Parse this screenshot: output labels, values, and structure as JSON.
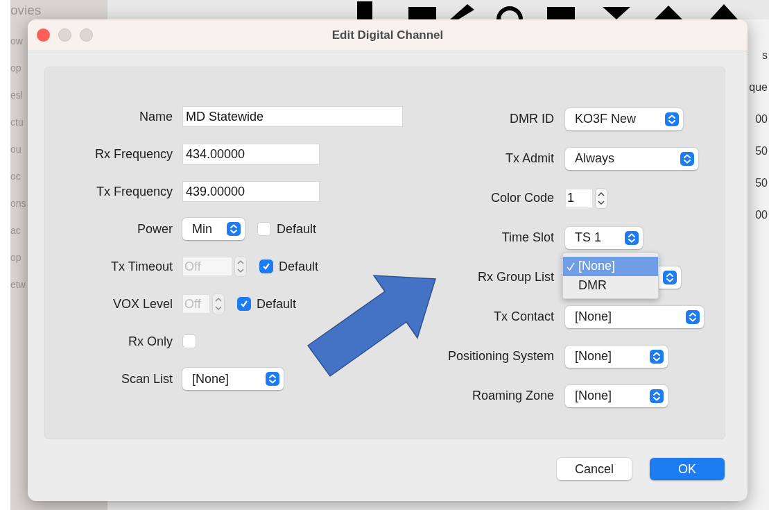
{
  "background": {
    "sidebar_items": [
      "ovies",
      "ow",
      "op",
      "esl",
      "ctu",
      "ou",
      "oc",
      "ons",
      "ac",
      "op",
      "etw"
    ],
    "table_fragments": [
      "s",
      "que",
      "00",
      "50",
      "50",
      "00"
    ]
  },
  "dialog": {
    "title": "Edit Digital Channel",
    "left_fields": [
      {
        "label": "Name",
        "kind": "text",
        "value": "MD Statewide"
      },
      {
        "label": "Rx Frequency",
        "kind": "text",
        "value": "434.00000"
      },
      {
        "label": "Tx Frequency",
        "kind": "text",
        "value": "439.00000"
      },
      {
        "label": "Power",
        "kind": "popup",
        "value": "Min",
        "checkbox": {
          "label": "Default",
          "checked": false
        }
      },
      {
        "label": "Tx Timeout",
        "kind": "stepper",
        "value": "Off",
        "disabled": true,
        "checkbox": {
          "label": "Default",
          "checked": true
        }
      },
      {
        "label": "VOX Level",
        "kind": "stepper",
        "value": "Off",
        "disabled": true,
        "checkbox": {
          "label": "Default",
          "checked": true
        }
      },
      {
        "label": "Rx Only",
        "kind": "checkbox",
        "checked": false
      },
      {
        "label": "Scan List",
        "kind": "popup",
        "value": "[None]"
      }
    ],
    "right_fields": [
      {
        "label": "DMR ID",
        "kind": "popup",
        "value": "KO3F New"
      },
      {
        "label": "Tx Admit",
        "kind": "popup",
        "value": "Always"
      },
      {
        "label": "Color Code",
        "kind": "stepper",
        "value": "1",
        "disabled": false
      },
      {
        "label": "Time Slot",
        "kind": "popup",
        "value": "TS 1"
      },
      {
        "label": "Rx Group List",
        "kind": "popup",
        "menu": [
          {
            "label": "[None]",
            "selected": true
          },
          {
            "label": "DMR",
            "selected": false
          }
        ]
      },
      {
        "label": "Tx Contact",
        "kind": "popup",
        "value": "[None]"
      },
      {
        "label": "Positioning System",
        "kind": "popup",
        "value": "[None]"
      },
      {
        "label": "Roaming Zone",
        "kind": "popup",
        "value": "[None]"
      }
    ],
    "buttons": [
      {
        "label": "Cancel",
        "kind": "secondary"
      },
      {
        "label": "OK",
        "kind": "default"
      }
    ]
  }
}
